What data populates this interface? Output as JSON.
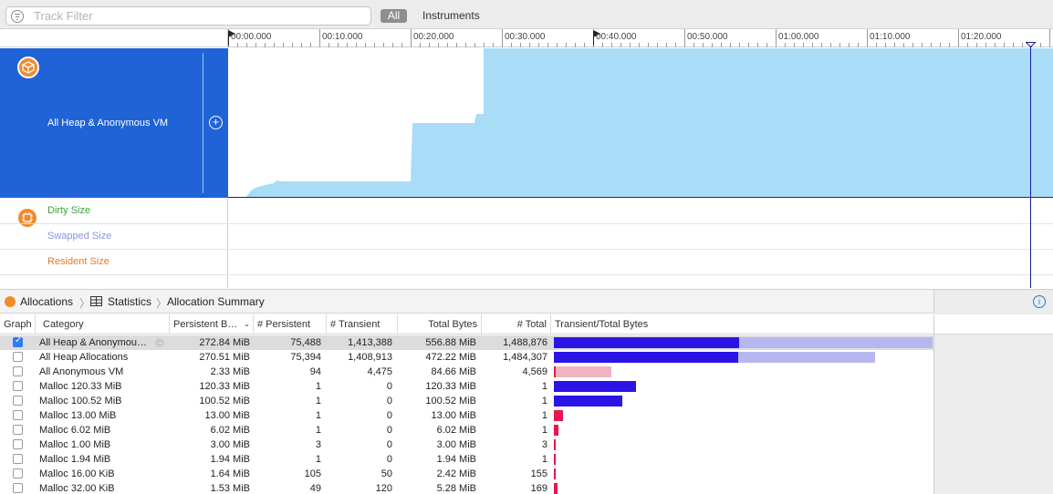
{
  "toolbar": {
    "filter_placeholder": "Track Filter",
    "scope_all": "All",
    "scope_instruments": "Instruments"
  },
  "timeline": {
    "ticks": [
      "00:00.000",
      "00:10.000",
      "00:20.000",
      "00:30.000",
      "00:40.000",
      "00:50.000",
      "01:00.000",
      "01:10.000",
      "01:20.000"
    ]
  },
  "track": {
    "name": "All Heap & Anonymous VM",
    "add_label": "+"
  },
  "subtracks": {
    "dirty": "Dirty Size",
    "swapped": "Swapped Size",
    "resident": "Resident Size"
  },
  "breadcrumb": {
    "instrument": "Allocations",
    "view": "Statistics",
    "detail": "Allocation Summary"
  },
  "info_label": "i",
  "colors": {
    "track_blue": "#1f63d6",
    "graph_fill": "#a8dcf7",
    "instrument_orange": "#f28a2c",
    "persistent_bar": "#2b14e6",
    "transient_bar": "#b7b7f0",
    "pink_bar": "#f0b3c0",
    "red_bar": "#e8154f",
    "dirty_green": "#3aa53a",
    "swapped_purple": "#8f8fe6",
    "resident_orange": "#e07b2c"
  },
  "table": {
    "columns": {
      "graph": "Graph",
      "category": "Category",
      "persistent_bytes": "Persistent B…",
      "persistent": "# Persistent",
      "transient": "# Transient",
      "total_bytes": "Total Bytes",
      "total": "# Total",
      "ratio": "Transient/Total Bytes"
    },
    "rows": [
      {
        "checked": true,
        "category": "All Heap & Anonymou…",
        "persistent_bytes": "272.84 MiB",
        "persistent": "75,488",
        "transient": "1,413,388",
        "total_bytes": "556.88 MiB",
        "total": "1,488,876",
        "persistent_frac": 0.49,
        "total_frac": 1.0,
        "style": "blue"
      },
      {
        "checked": false,
        "category": "All Heap Allocations",
        "persistent_bytes": "270.51 MiB",
        "persistent": "75,394",
        "transient": "1,408,913",
        "total_bytes": "472.22 MiB",
        "total": "1,484,307",
        "persistent_frac": 0.486,
        "total_frac": 0.848,
        "style": "blue"
      },
      {
        "checked": false,
        "category": "All Anonymous VM",
        "persistent_bytes": "2.33 MiB",
        "persistent": "94",
        "transient": "4,475",
        "total_bytes": "84.66 MiB",
        "total": "4,569",
        "persistent_frac": 0.004,
        "total_frac": 0.152,
        "style": "pink"
      },
      {
        "checked": false,
        "category": "Malloc 120.33 MiB",
        "persistent_bytes": "120.33 MiB",
        "persistent": "1",
        "transient": "0",
        "total_bytes": "120.33 MiB",
        "total": "1",
        "persistent_frac": 0.216,
        "total_frac": 0.216,
        "style": "blue"
      },
      {
        "checked": false,
        "category": "Malloc 100.52 MiB",
        "persistent_bytes": "100.52 MiB",
        "persistent": "1",
        "transient": "0",
        "total_bytes": "100.52 MiB",
        "total": "1",
        "persistent_frac": 0.181,
        "total_frac": 0.181,
        "style": "blue"
      },
      {
        "checked": false,
        "category": "Malloc 13.00 MiB",
        "persistent_bytes": "13.00 MiB",
        "persistent": "1",
        "transient": "0",
        "total_bytes": "13.00 MiB",
        "total": "1",
        "persistent_frac": 0.023,
        "total_frac": 0.023,
        "style": "red"
      },
      {
        "checked": false,
        "category": "Malloc 6.02 MiB",
        "persistent_bytes": "6.02 MiB",
        "persistent": "1",
        "transient": "0",
        "total_bytes": "6.02 MiB",
        "total": "1",
        "persistent_frac": 0.011,
        "total_frac": 0.011,
        "style": "red"
      },
      {
        "checked": false,
        "category": "Malloc 1.00 MiB",
        "persistent_bytes": "3.00 MiB",
        "persistent": "3",
        "transient": "0",
        "total_bytes": "3.00 MiB",
        "total": "3",
        "persistent_frac": 0.005,
        "total_frac": 0.005,
        "style": "red"
      },
      {
        "checked": false,
        "category": "Malloc 1.94 MiB",
        "persistent_bytes": "1.94 MiB",
        "persistent": "1",
        "transient": "0",
        "total_bytes": "1.94 MiB",
        "total": "1",
        "persistent_frac": 0.0035,
        "total_frac": 0.0035,
        "style": "red"
      },
      {
        "checked": false,
        "category": "Malloc 16.00 KiB",
        "persistent_bytes": "1.64 MiB",
        "persistent": "105",
        "transient": "50",
        "total_bytes": "2.42 MiB",
        "total": "155",
        "persistent_frac": 0.003,
        "total_frac": 0.0043,
        "style": "red"
      },
      {
        "checked": false,
        "category": "Malloc 32.00 KiB",
        "persistent_bytes": "1.53 MiB",
        "persistent": "49",
        "transient": "120",
        "total_bytes": "5.28 MiB",
        "total": "169",
        "persistent_frac": 0.0027,
        "total_frac": 0.0095,
        "style": "red"
      }
    ]
  }
}
